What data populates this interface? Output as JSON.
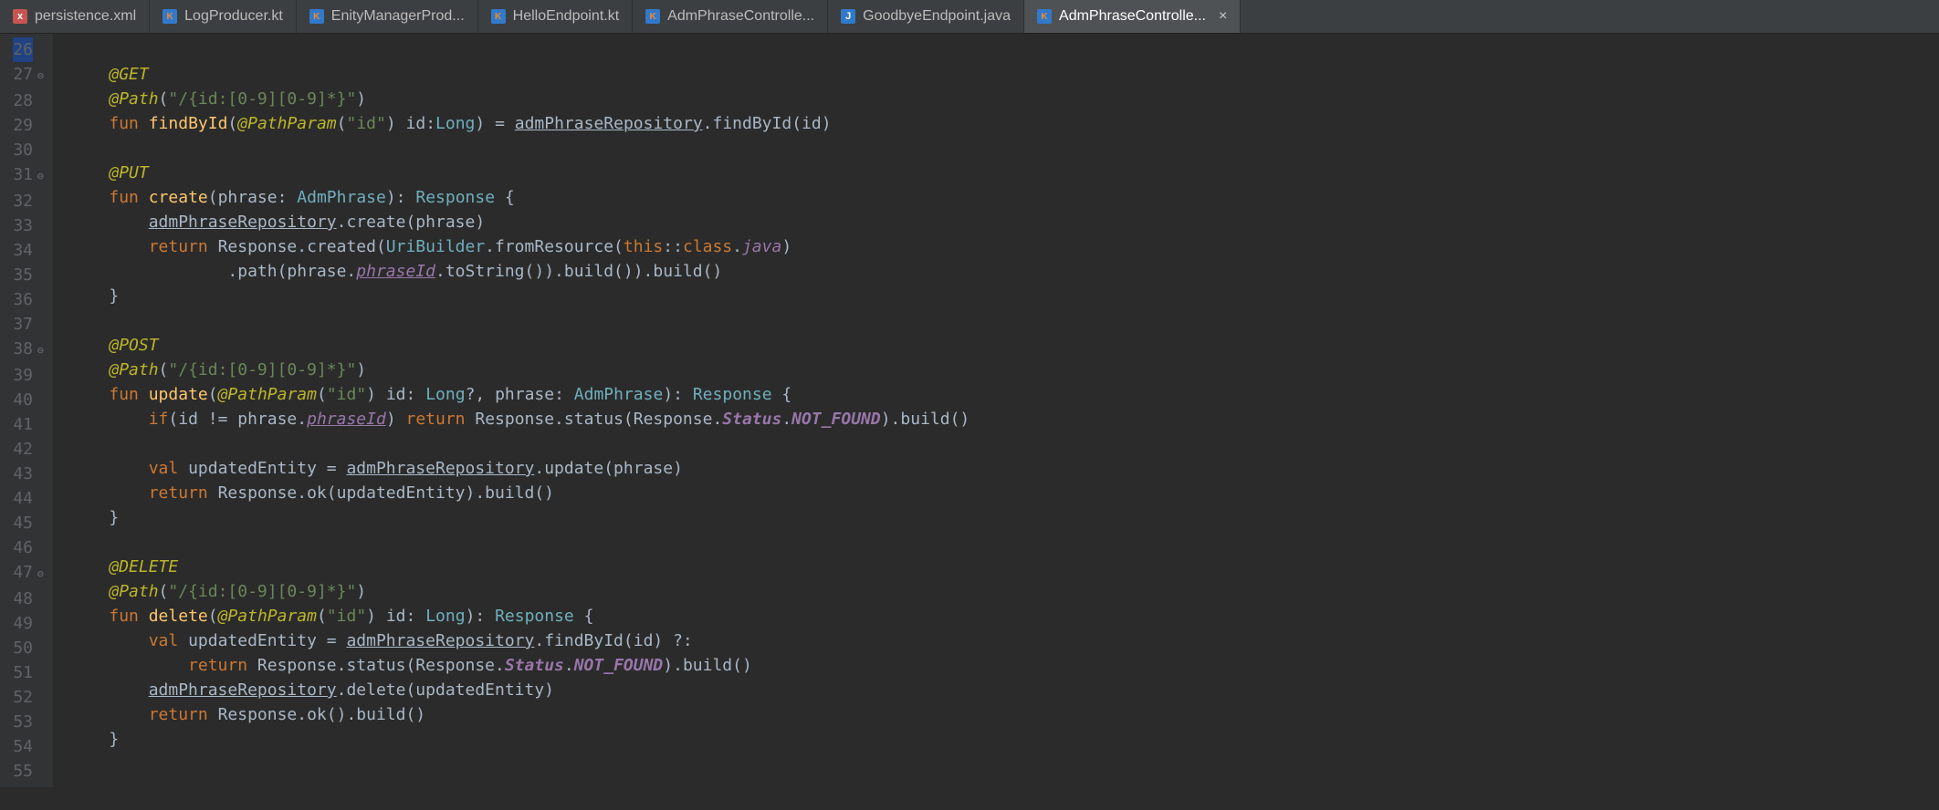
{
  "tabs": [
    {
      "label": "persistence.xml",
      "iconType": "xml",
      "active": false
    },
    {
      "label": "LogProducer.kt",
      "iconType": "kt",
      "active": false
    },
    {
      "label": "EnityManagerProd...",
      "iconType": "kt",
      "active": false
    },
    {
      "label": "HelloEndpoint.kt",
      "iconType": "kt",
      "active": false
    },
    {
      "label": "AdmPhraseControlle...",
      "iconType": "kt",
      "active": false
    },
    {
      "label": "GoodbyeEndpoint.java",
      "iconType": "java",
      "active": false
    },
    {
      "label": "AdmPhraseControlle...",
      "iconType": "kt",
      "active": true,
      "closable": true
    }
  ],
  "gutter": {
    "start": 26,
    "end": 55,
    "foldLines": [
      27,
      31,
      38,
      47
    ],
    "highlightLine": 26
  },
  "code": {
    "l26": "",
    "l27": {
      "anno": "@GET"
    },
    "l28": {
      "anno": "@Path",
      "p1": "(",
      "str": "\"/{id:[0-9][0-9]*}\"",
      "p2": ")"
    },
    "l29": {
      "kw": "fun ",
      "fn": "findById",
      "p1": "(",
      "anno": "@PathParam",
      "p2": "(",
      "str": "\"id\"",
      "p3": ") id:",
      "type": "Long",
      "p4": ") = ",
      "link": "admPhraseRepository",
      "p5": ".findById(id)"
    },
    "l30": "",
    "l31": {
      "anno": "@PUT"
    },
    "l32": {
      "kw": "fun ",
      "fn": "create",
      "p1": "(phrase: ",
      "type": "AdmPhrase",
      "p2": "): ",
      "type2": "Response",
      "p3": " {"
    },
    "l33": {
      "link": "admPhraseRepository",
      "p1": ".create(phrase)"
    },
    "l34": {
      "kw": "return ",
      "t1": "Response.created(",
      "type": "UriBuilder",
      "t2": ".fromResource(",
      "kw2": "this",
      "t3": "::",
      "kw3": "class",
      "t4": ".",
      "field": "java",
      "t5": ")"
    },
    "l35": {
      "t1": ".path(phrase.",
      "link": "phraseId",
      "t2": ".toString()).build()).build()"
    },
    "l36": {
      "t1": "}"
    },
    "l37": "",
    "l38": {
      "anno": "@POST"
    },
    "l39": {
      "anno": "@Path",
      "p1": "(",
      "str": "\"/{id:[0-9][0-9]*}\"",
      "p2": ")"
    },
    "l40": {
      "kw": "fun ",
      "fn": "update",
      "p1": "(",
      "anno": "@PathParam",
      "p2": "(",
      "str": "\"id\"",
      "p3": ") id: ",
      "type": "Long",
      "p4": "?, phrase: ",
      "type2": "AdmPhrase",
      "p5": "): ",
      "type3": "Response",
      "p6": " {"
    },
    "l41": {
      "kw": "if",
      "t1": "(id != phrase.",
      "link": "phraseId",
      "t2": ") ",
      "kw2": "return ",
      "t3": "Response.status(Response.",
      "stat": "Status",
      "t4": ".",
      "nf": "NOT_FOUND",
      "t5": ").build()"
    },
    "l42": "",
    "l43": {
      "kw": "val ",
      "v": "updatedEntity = ",
      "link": "admPhraseRepository",
      "t1": ".update(phrase)"
    },
    "l44": {
      "kw": "return ",
      "t1": "Response.ok(updatedEntity).build()"
    },
    "l45": {
      "t1": "}"
    },
    "l46": "",
    "l47": {
      "anno": "@DELETE"
    },
    "l48": {
      "anno": "@Path",
      "p1": "(",
      "str": "\"/{id:[0-9][0-9]*}\"",
      "p2": ")"
    },
    "l49": {
      "kw": "fun ",
      "fn": "delete",
      "p1": "(",
      "anno": "@PathParam",
      "p2": "(",
      "str": "\"id\"",
      "p3": ") id: ",
      "type": "Long",
      "p4": "): ",
      "type2": "Response",
      "p5": " {"
    },
    "l50": {
      "kw": "val ",
      "v": "updatedEntity = ",
      "link": "admPhraseRepository",
      "t1": ".findById(id) ?:"
    },
    "l51": {
      "kw": "return ",
      "t1": "Response.status(Response.",
      "stat": "Status",
      "t2": ".",
      "nf": "NOT_FOUND",
      "t3": ").build()"
    },
    "l52": {
      "link": "admPhraseRepository",
      "t1": ".delete(updatedEntity)"
    },
    "l53": {
      "kw": "return ",
      "t1": "Response.ok().build()"
    },
    "l54": {
      "t1": "}"
    },
    "l55": ""
  }
}
